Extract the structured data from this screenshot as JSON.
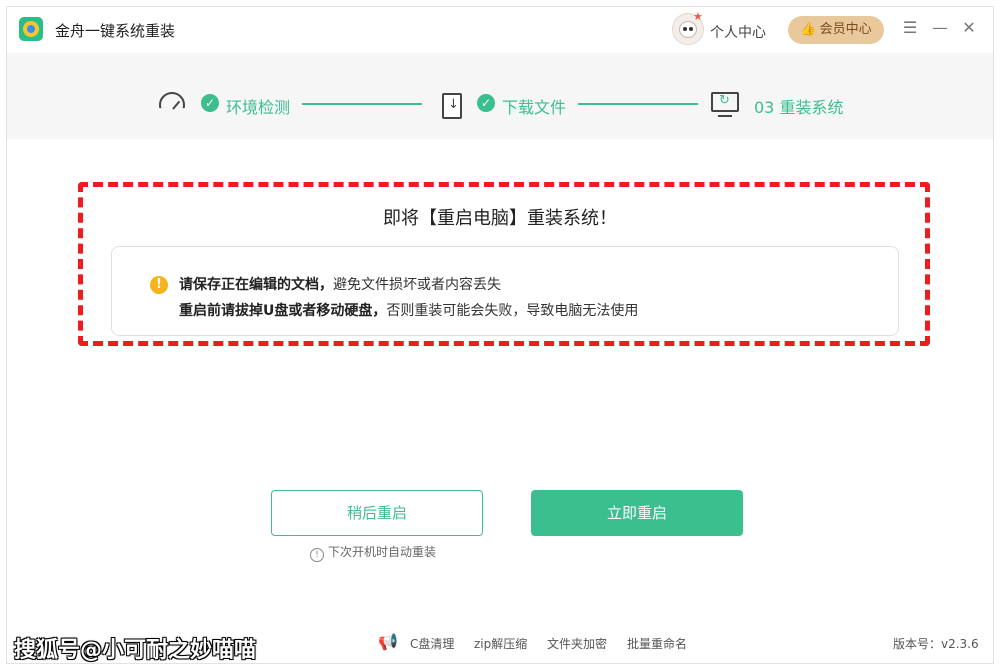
{
  "app": {
    "title": "金舟一键系统重装"
  },
  "header": {
    "personal_center": "个人中心",
    "member_center": "会员中心",
    "member_icon": "👍",
    "menu_icon": "☰",
    "minimize_icon": "—",
    "close_icon": "✕"
  },
  "steps": [
    {
      "label": "环境检测",
      "icon": "gauge-icon",
      "done": true
    },
    {
      "label": "下载文件",
      "icon": "download-doc-icon",
      "done": true
    },
    {
      "label": "03 重装系统",
      "icon": "monitor-restart-icon",
      "done": false
    }
  ],
  "check_mark": "✓",
  "notice": {
    "headline": "即将【重启电脑】重装系统！",
    "warn_icon": "!",
    "line1_bold": "请保存正在编辑的文档，",
    "line1_rest": "避免文件损坏或者内容丢失",
    "line2_bold": "重启前请拔掉U盘或者移动硬盘，",
    "line2_rest": "否则重装可能会失败，导致电脑无法使用"
  },
  "buttons": {
    "later": "稍后重启",
    "now": "立即重启"
  },
  "hint": {
    "icon": "!",
    "text": "下次开机时自动重装"
  },
  "footer": {
    "tools": [
      "C盘清理",
      "zip解压缩",
      "文件夹加密",
      "批量重命名"
    ],
    "version": "版本号：v2.3.6"
  },
  "watermark": "搜狐号@小可耐之妙喵喵",
  "colors": {
    "accent": "#3bbf8f",
    "warning": "#f5b41d",
    "highlight_frame": "#ee1c1c",
    "member_badge": "#e9c89b"
  }
}
